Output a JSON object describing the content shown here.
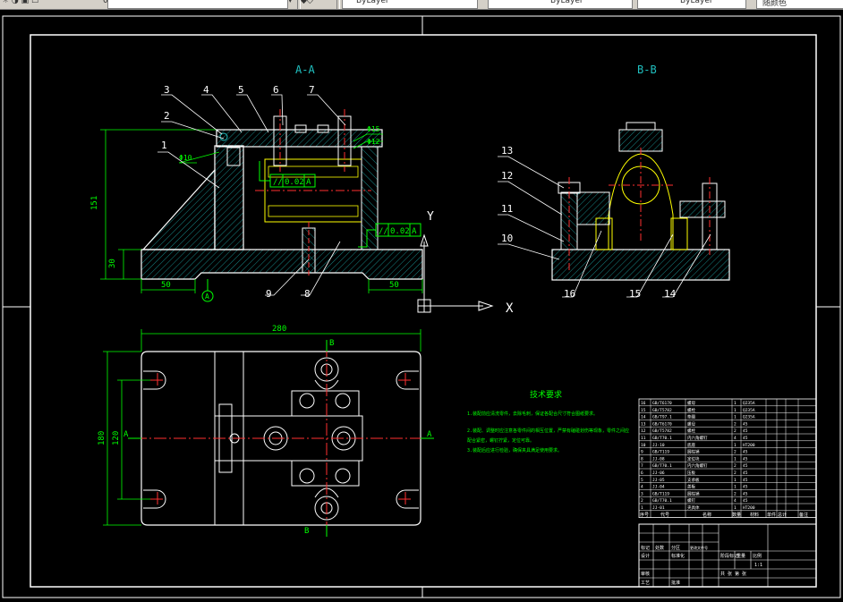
{
  "toolbar": {
    "layer_value": "0",
    "color_value": "ByLayer",
    "linetype_value": "ByLayer",
    "lineweight_value": "ByLayer",
    "plotstyle_value": "随颜色"
  },
  "drawing": {
    "section_aa": "A-A",
    "section_bb": "B-B",
    "callouts_aa": [
      "1",
      "2",
      "3",
      "4",
      "5",
      "6",
      "7",
      "8",
      "9"
    ],
    "callouts_bb": [
      "10",
      "11",
      "12",
      "13",
      "14",
      "15",
      "16"
    ],
    "dims": {
      "overall_height": "151",
      "base_height": "30",
      "left_50": "50",
      "right_50": "50",
      "top_length": "280",
      "width_180": "180",
      "width_120": "120",
      "phi10": "Φ10",
      "phi15": "Φ15",
      "phi12": "Φ12"
    },
    "tolerance_1": "0.02",
    "tolerance_2": "0.02",
    "datum": "A",
    "datum_circle": "A",
    "label_a_left": "A",
    "label_a_right": "A",
    "label_b_top": "B",
    "label_b_bottom": "B",
    "ucs_x": "X",
    "ucs_y": "Y",
    "tech_title": "技术要求",
    "tech_lines": [
      "1.装配前应清洗零件，去除毛刺，保证各配合尺寸符合图纸要求。",
      "2.装配、调整时应注意各零件间的相互位置，严禁有磕碰划伤等现象，零件之间应",
      "  配合紧密，螺钉拧紧，定位可靠。",
      "3.装配后应进行检验，确保夹具满足使用要求。"
    ],
    "bom_headers": [
      "序号",
      "代号",
      "名称",
      "数量",
      "材料",
      "单件",
      "总计",
      "备注"
    ],
    "bom_rows": [
      [
        "16",
        "GB/T6170",
        "螺母",
        "1",
        "Q235A"
      ],
      [
        "15",
        "GB/T5782",
        "螺栓",
        "1",
        "Q235A"
      ],
      [
        "14",
        "GB/T97.1",
        "垫圈",
        "1",
        "Q235A"
      ],
      [
        "13",
        "GB/T6170",
        "螺母",
        "2",
        "45"
      ],
      [
        "12",
        "GB/T5782",
        "螺栓",
        "2",
        "45"
      ],
      [
        "11",
        "GB/T70.1",
        "内六角螺钉",
        "4",
        "45"
      ],
      [
        "10",
        "JJ-10",
        "底座",
        "1",
        "HT200"
      ],
      [
        "9",
        "GB/T119",
        "圆柱销",
        "2",
        "45"
      ],
      [
        "8",
        "JJ-08",
        "定位块",
        "1",
        "45"
      ],
      [
        "7",
        "GB/T70.1",
        "内六角螺钉",
        "2",
        "45"
      ],
      [
        "6",
        "JJ-06",
        "压板",
        "2",
        "45"
      ],
      [
        "5",
        "JJ-05",
        "支承板",
        "1",
        "45"
      ],
      [
        "4",
        "JJ-04",
        "盖板",
        "1",
        "45"
      ],
      [
        "3",
        "GB/T119",
        "圆柱销",
        "2",
        "45"
      ],
      [
        "2",
        "GB/T70.1",
        "螺钉",
        "4",
        "45"
      ],
      [
        "1",
        "JJ-01",
        "夹具体",
        "1",
        "HT200"
      ]
    ],
    "title_block": {
      "r1": [
        "标记",
        "处数",
        "分区",
        "更改文件号",
        "签名",
        "年月日"
      ],
      "r2": [
        "设计",
        "",
        "标准化",
        ""
      ],
      "r3": [
        "审核",
        ""
      ],
      "r4": [
        "工艺",
        "",
        "批准",
        ""
      ],
      "stage": "阶段标记",
      "weight": "重量",
      "scale": "比例",
      "scale_value": "1:1",
      "sheets": "共 张 第 张"
    }
  }
}
